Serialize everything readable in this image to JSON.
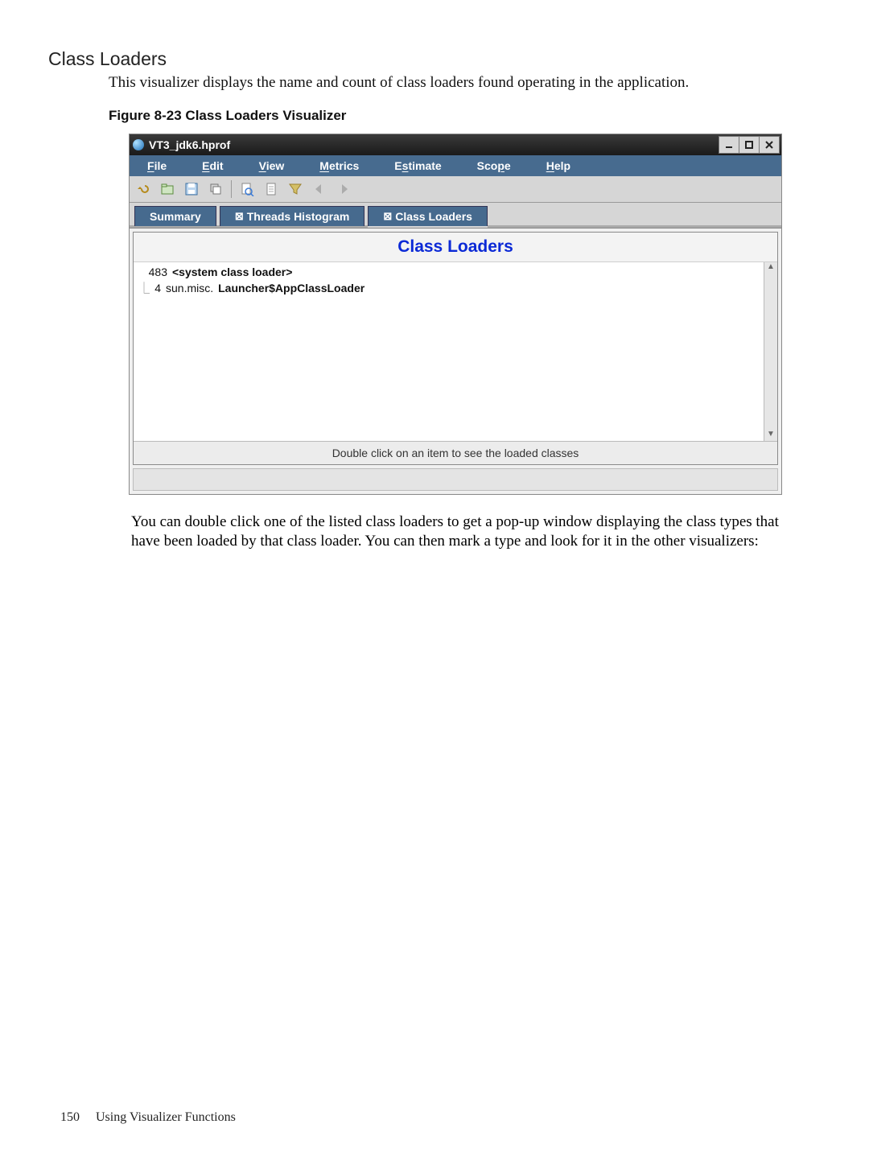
{
  "section_title": "Class Loaders",
  "intro": "This visualizer displays the name and count of class loaders found operating in the application.",
  "figure_caption": "Figure 8-23 Class Loaders Visualizer",
  "window": {
    "title": "VT3_jdk6.hprof",
    "menu": [
      "File",
      "Edit",
      "View",
      "Metrics",
      "Estimate",
      "Scope",
      "Help"
    ],
    "menu_uidx": [
      0,
      0,
      0,
      0,
      1,
      3,
      0
    ],
    "tabs": {
      "summary": "Summary",
      "threads": "Threads Histogram",
      "class_loaders": "Class Loaders"
    },
    "panel_title": "Class Loaders",
    "rows": [
      {
        "count": "483",
        "label": "<system class loader>"
      },
      {
        "count": "4",
        "prefix": "sun.misc.",
        "bold": "Launcher$AppClassLoader"
      }
    ],
    "hint": "Double click on an item to see the loaded classes"
  },
  "post_text": "You can double click one of the listed class loaders to get a pop-up window displaying the class types that have been loaded by that class loader. You can then mark a type and look for it in the other visualizers:",
  "footer": {
    "page": "150",
    "label": "Using Visualizer Functions"
  }
}
